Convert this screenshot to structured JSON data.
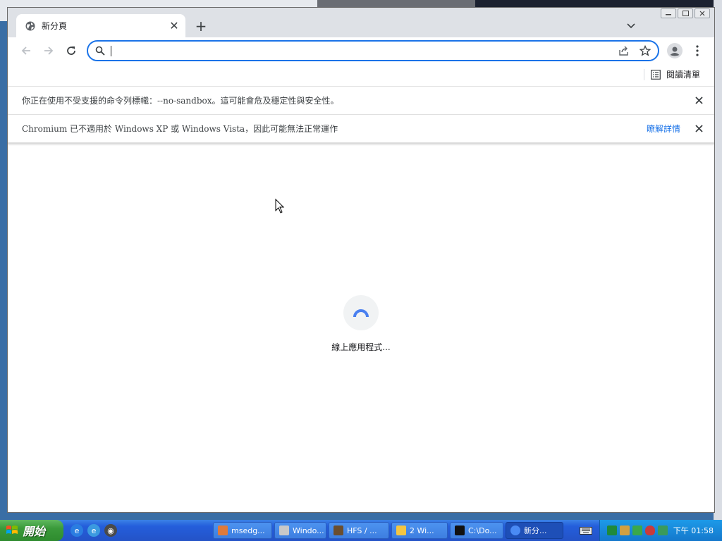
{
  "browser": {
    "tab": {
      "title": "新分頁",
      "close": "✕"
    },
    "new_tab": "+",
    "omnibox": {
      "value": "",
      "placeholder": ""
    },
    "bookmarks_bar": {
      "reading_list": "閱讀清單"
    },
    "infobars": [
      {
        "message": "你正在使用不受支援的命令列標幟：--no-sandbox。這可能會危及穩定性與安全性。",
        "link": ""
      },
      {
        "message": "Chromium 已不適用於 Windows XP 或 Windows Vista，因此可能無法正常運作",
        "link": "瞭解詳情"
      }
    ],
    "loading_text": "線上應用程式..."
  },
  "taskbar": {
    "start_label": "開始",
    "tasks": [
      {
        "label": "msedg...",
        "icon_color": "#e07a3a"
      },
      {
        "label": "Windo...",
        "icon_color": "#c8c8c8"
      },
      {
        "label": "HFS / ...",
        "icon_color": "#6b4e2e"
      },
      {
        "label": "2 Wi...",
        "icon_color": "#f4c542"
      },
      {
        "label": "C:\\Do...",
        "icon_color": "#111111"
      },
      {
        "label": "新分...",
        "icon_color": "#4a8af4"
      }
    ],
    "clock": "下午 01:58"
  },
  "colors": {
    "accent": "#1a73e8",
    "taskbar": "#245edb",
    "start": "#3a9a3a"
  }
}
